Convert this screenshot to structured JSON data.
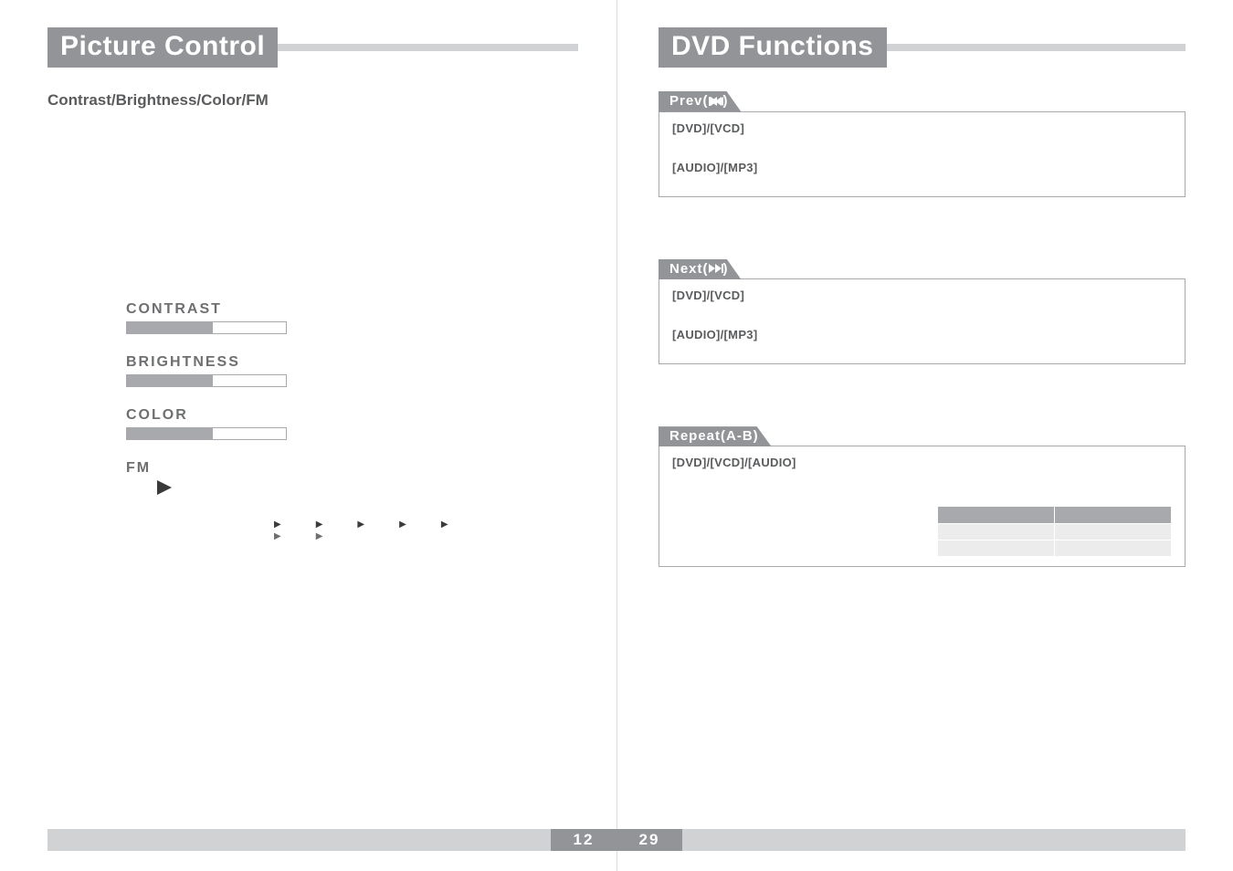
{
  "left": {
    "title": "Picture Control",
    "sub": "Contrast/Brightness/Color/FM",
    "sliders": {
      "contrast": {
        "label": "CONTRAST",
        "fillPct": 54
      },
      "brightness": {
        "label": "BRIGHTNESS",
        "fillPct": 54
      },
      "color": {
        "label": "COLOR",
        "fillPct": 54
      },
      "fm": {
        "label": "FM"
      }
    },
    "pageNum": "12"
  },
  "right": {
    "title": "DVD Functions",
    "prev": {
      "tab": "Prev(",
      "row1": "[DVD]/[VCD]",
      "row2": "[AUDIO]/[MP3]"
    },
    "next": {
      "tab": "Next(",
      "row1": "[DVD]/[VCD]",
      "row2": "[AUDIO]/[MP3]"
    },
    "repeat": {
      "tab": "Repeat(A-B)",
      "row1": "[DVD]/[VCD]/[AUDIO]"
    },
    "pageNum": "29"
  }
}
